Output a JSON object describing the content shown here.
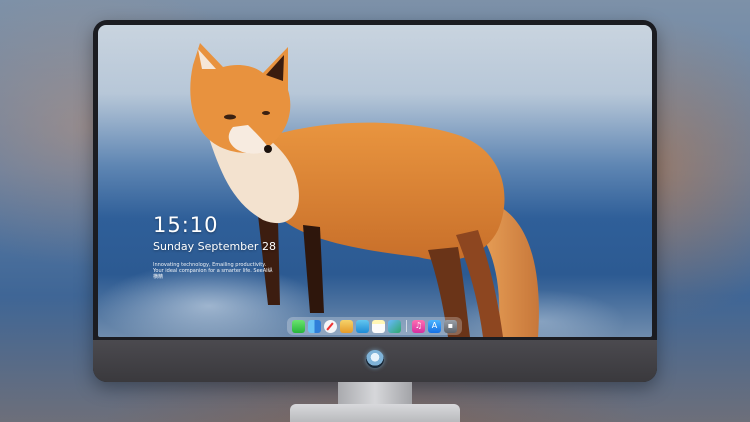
{
  "lock_screen": {
    "time": "15:10",
    "date": "Sunday September 28",
    "tagline": "Innovating technology, Emailing productivity. Your ideal companion for a smarter life. SeeAI纵横精"
  },
  "dock": {
    "items": [
      {
        "name": "messages",
        "icon": "messages-icon"
      },
      {
        "name": "finder",
        "icon": "finder-icon"
      },
      {
        "name": "safari",
        "icon": "compass-icon"
      },
      {
        "name": "preview",
        "icon": "preview-icon"
      },
      {
        "name": "claquette",
        "icon": "clapperboard-icon"
      },
      {
        "name": "notes",
        "icon": "notes-icon"
      },
      {
        "name": "photos",
        "icon": "photos-icon"
      },
      {
        "name": "music",
        "icon": "music-note-icon"
      },
      {
        "name": "app-store",
        "icon": "app-store-icon"
      },
      {
        "name": "disk-utility",
        "icon": "drive-icon"
      }
    ]
  },
  "colors": {
    "monitor_bezel": "#1b1c21",
    "monitor_chin": "#4b4a4f",
    "fox_fur": "#e08a3a"
  }
}
